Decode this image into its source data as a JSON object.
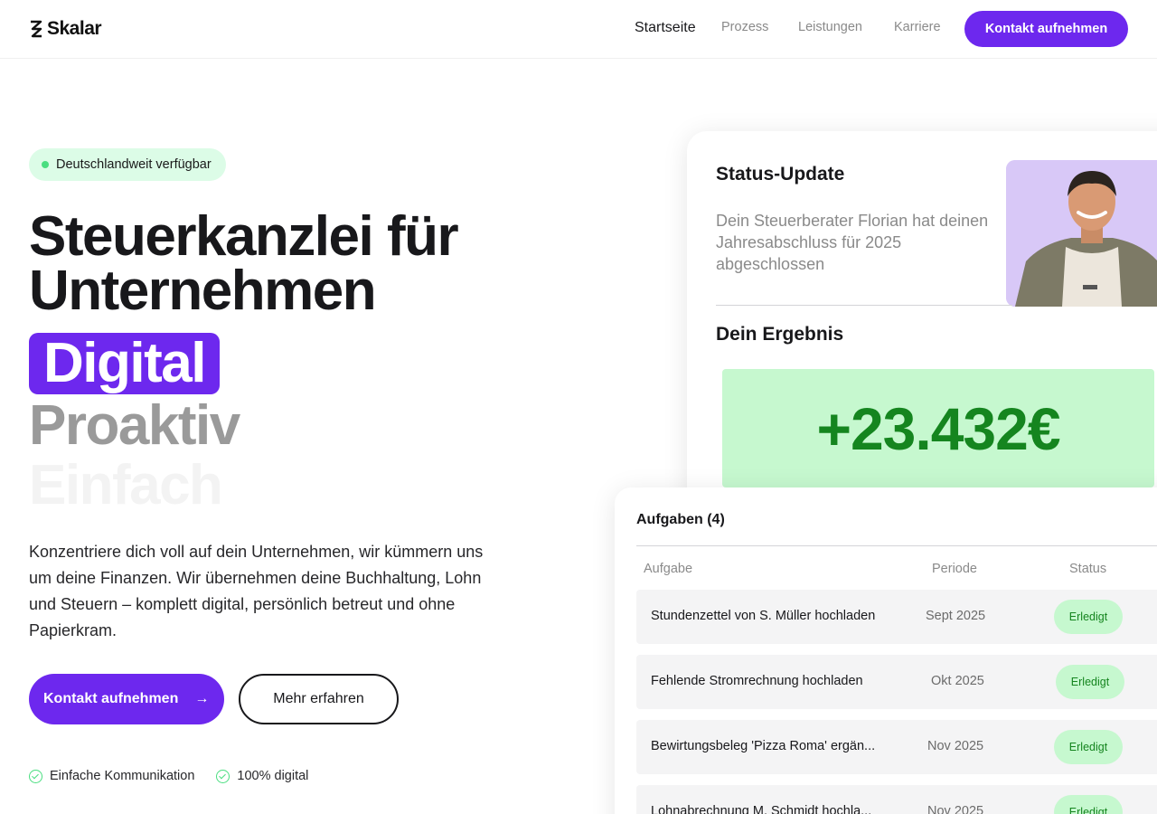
{
  "brand": {
    "name": "Skalar"
  },
  "nav": {
    "items": [
      {
        "label": "Startseite",
        "active": true
      },
      {
        "label": "Prozess"
      },
      {
        "label": "Leistungen"
      },
      {
        "label": "Karriere"
      }
    ],
    "cta": "Kontakt aufnehmen"
  },
  "hero": {
    "badge": "Deutschlandweit verfügbar",
    "title_line1": "Steuerkanzlei für",
    "title_line2": "Unternehmen",
    "words": [
      "Digital",
      "Proaktiv",
      "Einfach"
    ],
    "lead": "Konzentriere dich voll auf dein Unternehmen, wir kümmern uns um deine Finanzen. Wir übernehmen deine Buchhaltung, Lohn und Steuern – komplett digital, persönlich betreut und ohne Papierkram.",
    "cta_primary": "Kontakt aufnehmen",
    "cta_arrow": "→",
    "cta_secondary": "Mehr erfahren",
    "features": [
      "Einfache Kommunikation",
      "100% digital"
    ]
  },
  "status_card": {
    "title": "Status-Update",
    "text": "Dein Steuerberater Florian hat deinen Jahresabschluss für 2025 abgeschlossen",
    "result_title": "Dein Ergebnis",
    "result_value": "+23.432€"
  },
  "tasks_card": {
    "title": "Aufgaben (4)",
    "columns": [
      "Aufgabe",
      "Periode",
      "Status"
    ],
    "rows": [
      {
        "task": "Stundenzettel von S. Müller hochladen",
        "period": "Sept 2025",
        "status": "Erledigt"
      },
      {
        "task": "Fehlende Stromrechnung hochladen",
        "period": "Okt 2025",
        "status": "Erledigt"
      },
      {
        "task": "Bewirtungsbeleg 'Pizza Roma' ergän...",
        "period": "Nov 2025",
        "status": "Erledigt"
      },
      {
        "task": "Lohnabrechnung M. Schmidt hochla...",
        "period": "Nov 2025",
        "status": "Erledigt"
      }
    ]
  },
  "colors": {
    "accent": "#6d28ee",
    "success_bg": "#c6f8cf",
    "success_text": "#15851f",
    "badge_bg": "#dcfce7"
  }
}
